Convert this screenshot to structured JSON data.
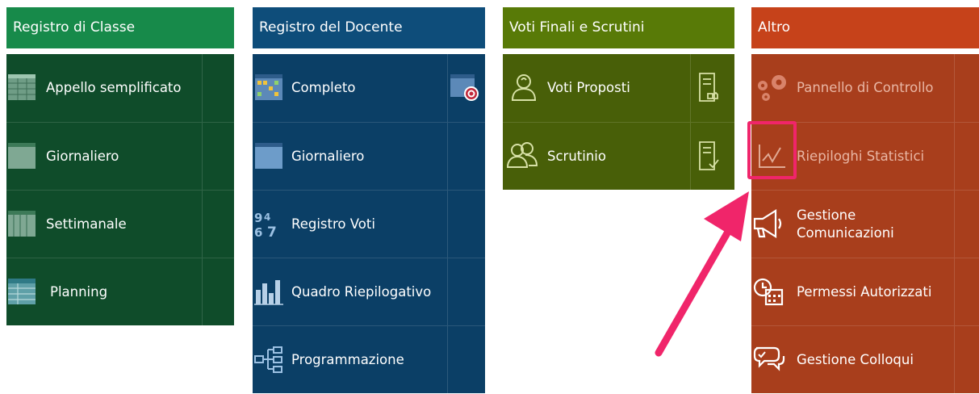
{
  "columns": {
    "classe": {
      "title": "Registro di Classe",
      "items": [
        {
          "label": "Appello semplificato",
          "icon": "attendance-grid-icon"
        },
        {
          "label": "Giornaliero",
          "icon": "daily-register-icon"
        },
        {
          "label": "Settimanale",
          "icon": "weekly-register-icon"
        },
        {
          "label": "Planning",
          "icon": "planning-grid-icon"
        }
      ]
    },
    "docente": {
      "title": "Registro del Docente",
      "items": [
        {
          "label": "Completo",
          "icon": "calendar-grid-icon",
          "right_icon": "target-calendar-icon"
        },
        {
          "label": "Giornaliero",
          "icon": "daily-register-icon"
        },
        {
          "label": "Registro Voti",
          "icon": "grades-numbers-icon"
        },
        {
          "label": "Quadro Riepilogativo",
          "icon": "bar-chart-icon"
        },
        {
          "label": "Programmazione",
          "icon": "hierarchy-icon"
        }
      ]
    },
    "voti": {
      "title": "Voti Finali e Scrutini",
      "items": [
        {
          "label": "Voti Proposti",
          "icon": "person-icon",
          "right_icon": "document-thumb-icon"
        },
        {
          "label": "Scrutinio",
          "icon": "group-icon",
          "right_icon": "document-check-icon"
        }
      ]
    },
    "altro": {
      "title": "Altro",
      "items": [
        {
          "label": "Pannello di Controllo",
          "icon": "gears-icon"
        },
        {
          "label": "Riepiloghi Statistici",
          "icon": "line-chart-icon"
        },
        {
          "label": "Gestione Comunicazioni",
          "icon": "megaphone-icon"
        },
        {
          "label": "Permessi Autorizzati",
          "icon": "clock-calendar-icon"
        },
        {
          "label": "Gestione Colloqui",
          "icon": "chat-bubbles-icon"
        }
      ]
    }
  },
  "colors": {
    "classe_header": "#178a4a",
    "classe_body": "#0f4c2a",
    "docente_header": "#0e4d7a",
    "docente_body": "#0b3f66",
    "voti_header": "#587a07",
    "voti_body": "#485f08",
    "altro_header": "#c6421a",
    "altro_body": "#a83e1c",
    "highlight": "#f0256a"
  }
}
